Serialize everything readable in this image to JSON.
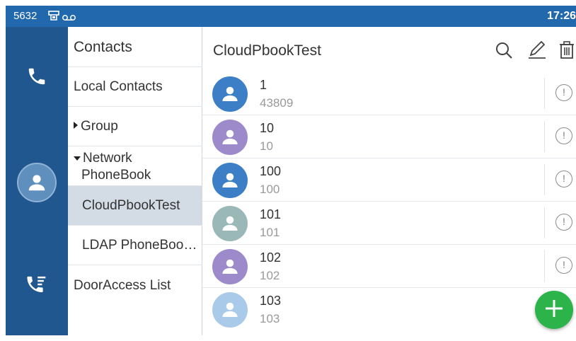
{
  "status_bar": {
    "extension": "5632",
    "time": "17:26"
  },
  "rail": {
    "items": [
      {
        "icon": "phone-icon"
      },
      {
        "icon": "contact-avatar-icon"
      },
      {
        "icon": "call-history-icon"
      }
    ]
  },
  "categories": {
    "title": "Contacts",
    "local": "Local Contacts",
    "group": "Group",
    "network_line1": "Network",
    "network_line2": "PhoneBook",
    "cloud": "CloudPbookTest",
    "ldap": "LDAP PhoneBoo…",
    "door": "DoorAccess List"
  },
  "main": {
    "title": "CloudPbookTest",
    "actions": [
      "search-icon",
      "edit-icon",
      "delete-icon"
    ]
  },
  "contacts": [
    {
      "name": "1",
      "number": "43809",
      "avatar_color": "#3d7fc6"
    },
    {
      "name": "10",
      "number": "10",
      "avatar_color": "#9c8acb"
    },
    {
      "name": "100",
      "number": "100",
      "avatar_color": "#3d7fc6"
    },
    {
      "name": "101",
      "number": "101",
      "avatar_color": "#9ab8b8"
    },
    {
      "name": "102",
      "number": "102",
      "avatar_color": "#9c8acb"
    },
    {
      "name": "103",
      "number": "103",
      "avatar_color": "#a9cae8"
    }
  ],
  "colors": {
    "accent": "#2268ad",
    "fab": "#2cb34a",
    "selected_row": "#d3dbe4"
  }
}
